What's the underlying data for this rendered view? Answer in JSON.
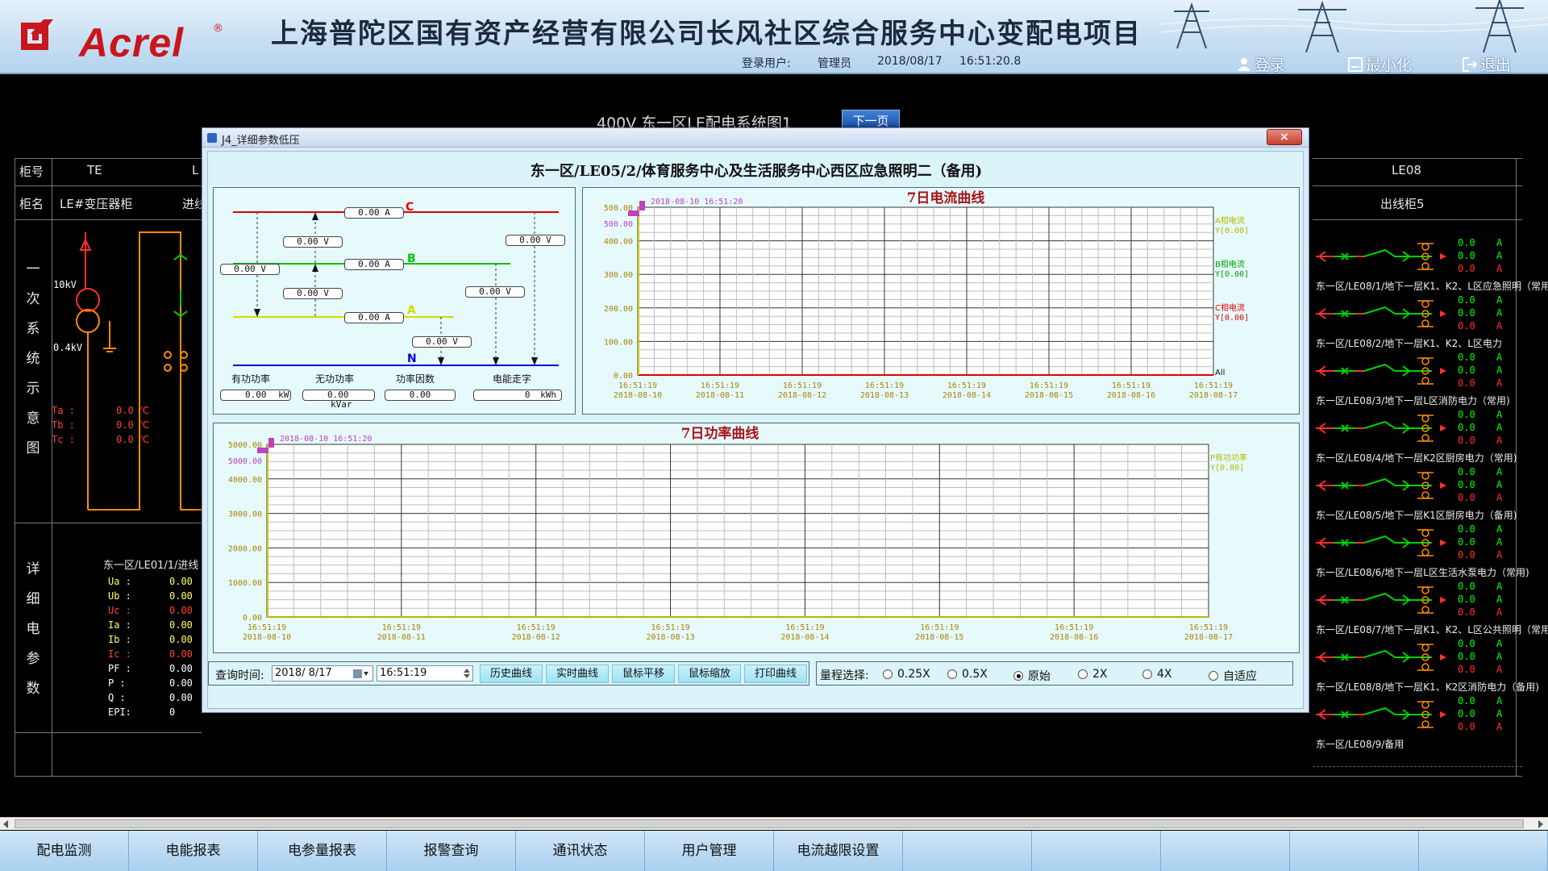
{
  "header": {
    "logo_text": "Acrel",
    "logo_reg": "®",
    "title": "上海普陀区国有资产经营有限公司长风社区综合服务中心变配电项目",
    "user_label": "登录用户:",
    "user_value": "管理员",
    "date": "2018/08/17",
    "time": "16:51:20.8",
    "login": "登录",
    "minimize": "最小化",
    "exit": "退出"
  },
  "diagram": {
    "title": "400V 东一区LE配电系统图1",
    "next_page": "下一页",
    "row_cabinet_no": "柜号",
    "row_cabinet_name": "柜名",
    "col_te": "TE",
    "col_l": "L",
    "col_le08": "LE08",
    "te_name": "LE#变压器柜",
    "l_name": "进线",
    "le08_name": "出线柜5",
    "side_primary": [
      "一",
      "次",
      "系",
      "统",
      "示",
      "意",
      "图"
    ],
    "side_detail": [
      "详",
      "细",
      "电",
      "参",
      "数"
    ],
    "hv": "10kV",
    "lv": "0.4kV",
    "temps": [
      {
        "label": "Ta :",
        "value": "0.0",
        "unit": "℃"
      },
      {
        "label": "Tb :",
        "value": "0.0",
        "unit": "℃"
      },
      {
        "label": "Tc :",
        "value": "0.0",
        "unit": "℃"
      }
    ],
    "detail_title": "东一区/LE01/1/进线",
    "detail_params": [
      {
        "label": "Ua :",
        "value": "0.00",
        "color": "#ffff66"
      },
      {
        "label": "Ub :",
        "value": "0.00",
        "color": "#ffff66"
      },
      {
        "label": "Uc :",
        "value": "0.00",
        "color": "#ff4040"
      },
      {
        "label": "Ia :",
        "value": "0.00",
        "color": "#ffff66"
      },
      {
        "label": "Ib :",
        "value": "0.00",
        "color": "#ffff66"
      },
      {
        "label": "Ic :",
        "value": "0.00",
        "color": "#ff4040"
      },
      {
        "label": "PF :",
        "value": "0.00",
        "color": "#ffffff"
      },
      {
        "label": "P :",
        "value": "0.00",
        "color": "#ffffff"
      },
      {
        "label": "Q :",
        "value": "0.00",
        "color": "#ffffff"
      },
      {
        "label": "EPI:",
        "value": "0",
        "color": "#ffffff"
      }
    ],
    "feeders": [
      {
        "values": [
          "0.0",
          "0.0",
          "0.0"
        ],
        "unit": "A",
        "label": "东一区/LE08/1/地下一层K1、K2、L区应急照明（常用)"
      },
      {
        "values": [
          "0.0",
          "0.0",
          "0.0"
        ],
        "unit": "A",
        "label": "东一区/LE08/2/地下一层K1、K2、L区电力"
      },
      {
        "values": [
          "0.0",
          "0.0",
          "0.0"
        ],
        "unit": "A",
        "label": "东一区/LE08/3/地下一层L区消防电力（常用)"
      },
      {
        "values": [
          "0.0",
          "0.0",
          "0.0"
        ],
        "unit": "A",
        "label": "东一区/LE08/4/地下一层K2区厨房电力（常用)"
      },
      {
        "values": [
          "0.0",
          "0.0",
          "0.0"
        ],
        "unit": "A",
        "label": "东一区/LE08/5/地下一层K1区厨房电力（备用)"
      },
      {
        "values": [
          "0.0",
          "0.0",
          "0.0"
        ],
        "unit": "A",
        "label": "东一区/LE08/6/地下一层L区生活水泵电力（常用)"
      },
      {
        "values": [
          "0.0",
          "0.0",
          "0.0"
        ],
        "unit": "A",
        "label": "东一区/LE08/7/地下一层K1、K2、L区公共照明（常用"
      },
      {
        "values": [
          "0.0",
          "0.0",
          "0.0"
        ],
        "unit": "A",
        "label": "东一区/LE08/8/地下一层K1、K2区消防电力（备用)"
      },
      {
        "values": [
          "0.0",
          "0.0",
          "0.0"
        ],
        "unit": "A",
        "label": "东一区/LE08/9/备用"
      }
    ]
  },
  "nav": [
    "配电监测",
    "电能报表",
    "电参量报表",
    "报警查询",
    "通讯状态",
    "用户管理",
    "电流越限设置",
    "",
    "",
    "",
    "",
    ""
  ],
  "dialog": {
    "title": "J4_详细参数低压",
    "close": "×",
    "heading": "东一区/LE05/2/体育服务中心及生活服务中心西区应急照明二（备用)",
    "phase_c": "C",
    "phase_b": "B",
    "phase_a": "A",
    "phase_n": "N",
    "current_c": "0.00 A",
    "current_b": "0.00 A",
    "current_a": "0.00 A",
    "v_ca": "0.00 V",
    "v_cb_top": "0.00 V",
    "v_bc": "0.00 V",
    "v_ab": "0.00 V",
    "v_cn": "0.00 V",
    "v_bn": "0.00 V",
    "v_an": "0.00 V",
    "sum_labels": [
      "有功功率",
      "无功功率",
      "功率因数",
      "电能走字"
    ],
    "sum_values": [
      "0.00",
      "0.00",
      "0.00",
      "0"
    ],
    "sum_units": [
      "kW",
      "kVar",
      "",
      "kWh"
    ],
    "query_label": "查询时间:",
    "query_date": "2018/ 8/17",
    "query_time": "16:51:19",
    "buttons": [
      "历史曲线",
      "实时曲线",
      "鼠标平移",
      "鼠标缩放",
      "打印曲线"
    ],
    "range_label": "量程选择:",
    "range_options": [
      "0.25X",
      "0.5X",
      "原始",
      "2X",
      "4X",
      "自适应"
    ],
    "range_selected": 2
  },
  "chart_data": [
    {
      "type": "line",
      "title": "7日电流曲线",
      "cursor_label": "2018-08-10 16:51:20",
      "cursor_value": "500.00",
      "x": [
        "2018-08-10 16:51:19",
        "2018-08-11 16:51:19",
        "2018-08-12 16:51:19",
        "2018-08-13 16:51:19",
        "2018-08-14 16:51:19",
        "2018-08-15 16:51:19",
        "2018-08-16 16:51:19",
        "2018-08-17 16:51:19"
      ],
      "x_time": "16:51:19",
      "x_dates": [
        "2018-08-10",
        "2018-08-11",
        "2018-08-12",
        "2018-08-13",
        "2018-08-14",
        "2018-08-15",
        "2018-08-16",
        "2018-08-17"
      ],
      "yticks": [
        "500.00",
        "400.00",
        "300.00",
        "200.00",
        "100.00",
        "0.00"
      ],
      "ylim": [
        0,
        500
      ],
      "series": [
        {
          "name": "A相电流",
          "y_label": "Y[0.00]",
          "color": "#b8b800",
          "values": [
            0,
            0,
            0,
            0,
            0,
            0,
            0,
            0
          ]
        },
        {
          "name": "B相电流",
          "y_label": "Y[0.00]",
          "color": "#00a000",
          "values": [
            0,
            0,
            0,
            0,
            0,
            0,
            0,
            0
          ]
        },
        {
          "name": "C相电流",
          "y_label": "Y[0.00]",
          "color": "#e00000",
          "values": [
            0,
            0,
            0,
            0,
            0,
            0,
            0,
            0
          ]
        }
      ],
      "legend_extra": "All"
    },
    {
      "type": "line",
      "title": "7日功率曲线",
      "cursor_label": "2018-08-10 16:51:20",
      "cursor_value": "5000.00",
      "x": [
        "2018-08-10 16:51:19",
        "2018-08-11 16:51:19",
        "2018-08-12 16:51:19",
        "2018-08-13 16:51:19",
        "2018-08-14 16:51:19",
        "2018-08-15 16:51:19",
        "2018-08-16 16:51:19",
        "2018-08-17 16:51:19"
      ],
      "x_time": "16:51:19",
      "x_dates": [
        "2018-08-10",
        "2018-08-11",
        "2018-08-12",
        "2018-08-13",
        "2018-08-14",
        "2018-08-15",
        "2018-08-16",
        "2018-08-17"
      ],
      "yticks": [
        "5000.00",
        "4000.00",
        "3000.00",
        "2000.00",
        "1000.00",
        "0.00"
      ],
      "ylim": [
        0,
        5000
      ],
      "series": [
        {
          "name": "P有功功率",
          "y_label": "Y[0.00]",
          "color": "#b8b800",
          "values": [
            0,
            0,
            0,
            0,
            0,
            0,
            0,
            0
          ]
        }
      ]
    }
  ]
}
